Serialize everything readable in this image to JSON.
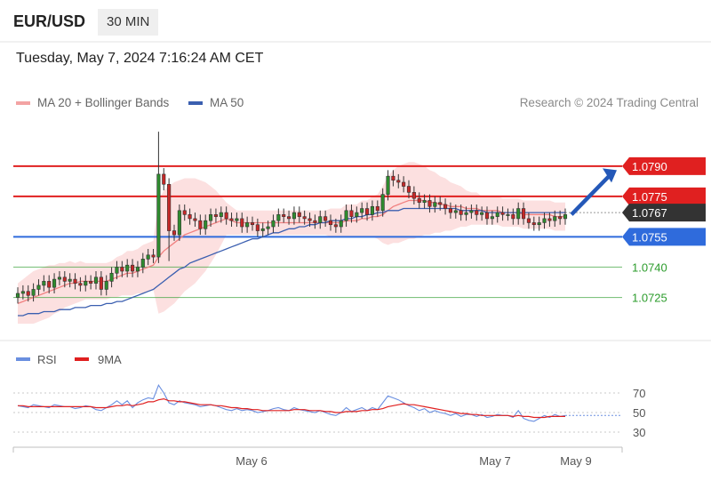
{
  "header": {
    "symbol": "EUR/USD",
    "timeframe": "30 MIN"
  },
  "timestamp": "Tuesday, May 7, 2024 7:16:24 AM CET",
  "legend": {
    "ma20": {
      "label": "MA 20 + Bollinger Bands",
      "color": "#f08080"
    },
    "ma50": {
      "label": "MA 50",
      "color": "#3b5fb0"
    }
  },
  "credit": "Research © 2024 Trading Central",
  "rsi_legend": {
    "rsi": {
      "label": "RSI",
      "color": "#6a8fe0"
    },
    "ma9": {
      "label": "9MA",
      "color": "#e02020"
    }
  },
  "chart_data": {
    "type": "candlestick",
    "price_ylim": [
      1.0705,
      1.0815
    ],
    "levels": [
      {
        "value": "1.0790",
        "num": 1.079,
        "kind": "resistance",
        "color": "#e02020",
        "badge": true
      },
      {
        "value": "1.0775",
        "num": 1.0775,
        "kind": "resistance",
        "color": "#e02020",
        "badge": true
      },
      {
        "value": "1.0767",
        "num": 1.0767,
        "kind": "current",
        "color": "#333333",
        "badge": true
      },
      {
        "value": "1.0755",
        "num": 1.0755,
        "kind": "pivot",
        "color": "#2f6bdc",
        "badge": true
      },
      {
        "value": "1.0740",
        "num": 1.074,
        "kind": "support",
        "color": "#2c9c2c",
        "badge": false
      },
      {
        "value": "1.0725",
        "num": 1.0725,
        "kind": "support",
        "color": "#2c9c2c",
        "badge": false
      }
    ],
    "forecast_target": 1.0788,
    "x_ticks": [
      "May 6",
      "May 7",
      "May 9"
    ],
    "rsi_ticks": [
      "70",
      "50",
      "30"
    ],
    "rsi_ylim": [
      20,
      90
    ],
    "candles_close": [
      1.0727,
      1.0728,
      1.0726,
      1.0729,
      1.0731,
      1.0733,
      1.073,
      1.0734,
      1.0735,
      1.0733,
      1.0734,
      1.0732,
      1.0731,
      1.0733,
      1.0732,
      1.0735,
      1.0729,
      1.0733,
      1.0737,
      1.074,
      1.0738,
      1.0741,
      1.0738,
      1.074,
      1.0744,
      1.0746,
      1.0745,
      1.0786,
      1.0781,
      1.0758,
      1.0756,
      1.0768,
      1.0766,
      1.0764,
      1.0763,
      1.0759,
      1.0763,
      1.0766,
      1.0765,
      1.0767,
      1.0764,
      1.0763,
      1.0764,
      1.076,
      1.0762,
      1.0761,
      1.0758,
      1.0759,
      1.076,
      1.0763,
      1.0766,
      1.0765,
      1.0764,
      1.0767,
      1.0765,
      1.0764,
      1.0763,
      1.0762,
      1.0765,
      1.0763,
      1.0761,
      1.076,
      1.0763,
      1.0768,
      1.0765,
      1.0767,
      1.0769,
      1.0766,
      1.077,
      1.0768,
      1.0776,
      1.0785,
      1.0783,
      1.0782,
      1.078,
      1.0777,
      1.0774,
      1.0772,
      1.0773,
      1.077,
      1.0772,
      1.0771,
      1.0769,
      1.0767,
      1.0768,
      1.0766,
      1.0767,
      1.0768,
      1.0766,
      1.0767,
      1.0764,
      1.0765,
      1.0767,
      1.0766,
      1.0766,
      1.0764,
      1.0769,
      1.0764,
      1.0762,
      1.0761,
      1.0762,
      1.0764,
      1.0763,
      1.0765,
      1.0764,
      1.0766
    ],
    "ma20": [
      1.0722,
      1.0723,
      1.0724,
      1.0725,
      1.0726,
      1.0727,
      1.0728,
      1.0729,
      1.073,
      1.0731,
      1.0732,
      1.0732,
      1.0733,
      1.0733,
      1.0733,
      1.0733,
      1.0733,
      1.0733,
      1.0734,
      1.0735,
      1.0736,
      1.0737,
      1.0737,
      1.0738,
      1.0739,
      1.074,
      1.0741,
      1.0745,
      1.0748,
      1.075,
      1.0752,
      1.0754,
      1.0756,
      1.0757,
      1.0758,
      1.0759,
      1.076,
      1.0761,
      1.0762,
      1.0763,
      1.0764,
      1.0763,
      1.0762,
      1.0762,
      1.0762,
      1.0762,
      1.0762,
      1.0762,
      1.0762,
      1.0762,
      1.0762,
      1.0762,
      1.0762,
      1.0762,
      1.0762,
      1.0762,
      1.0762,
      1.0762,
      1.0762,
      1.0762,
      1.0762,
      1.0762,
      1.0762,
      1.0763,
      1.0763,
      1.0763,
      1.0764,
      1.0764,
      1.0765,
      1.0765,
      1.0766,
      1.0768,
      1.077,
      1.0771,
      1.0772,
      1.0773,
      1.0773,
      1.0773,
      1.0773,
      1.0772,
      1.0772,
      1.0771,
      1.0771,
      1.077,
      1.077,
      1.077,
      1.0769,
      1.0769,
      1.0769,
      1.0768,
      1.0768,
      1.0768,
      1.0768,
      1.0767,
      1.0767,
      1.0767,
      1.0767,
      1.0766,
      1.0766,
      1.0766,
      1.0766,
      1.0766,
      1.0766,
      1.0765,
      1.0765,
      1.0765
    ],
    "ma50": [
      1.0716,
      1.0716,
      1.0717,
      1.0717,
      1.0717,
      1.0718,
      1.0718,
      1.0718,
      1.0719,
      1.0719,
      1.0719,
      1.072,
      1.072,
      1.072,
      1.0721,
      1.0721,
      1.0721,
      1.0722,
      1.0722,
      1.0723,
      1.0723,
      1.0724,
      1.0725,
      1.0726,
      1.0727,
      1.0728,
      1.0729,
      1.0731,
      1.0733,
      1.0735,
      1.0737,
      1.0739,
      1.074,
      1.0742,
      1.0743,
      1.0744,
      1.0745,
      1.0746,
      1.0747,
      1.0748,
      1.0749,
      1.075,
      1.0751,
      1.0752,
      1.0753,
      1.0754,
      1.0754,
      1.0755,
      1.0756,
      1.0757,
      1.0757,
      1.0758,
      1.0759,
      1.0759,
      1.076,
      1.076,
      1.0761,
      1.0761,
      1.0762,
      1.0762,
      1.0763,
      1.0763,
      1.0763,
      1.0764,
      1.0764,
      1.0765,
      1.0765,
      1.0766,
      1.0766,
      1.0767,
      1.0767,
      1.0768,
      1.0768,
      1.0768,
      1.0769,
      1.0769,
      1.0769,
      1.0769,
      1.0769,
      1.0769,
      1.0769,
      1.0769,
      1.0769,
      1.0769,
      1.0769,
      1.0768,
      1.0768,
      1.0768,
      1.0768,
      1.0768,
      1.0767,
      1.0767,
      1.0767,
      1.0767,
      1.0767,
      1.0767,
      1.0767,
      1.0767,
      1.0767,
      1.0767,
      1.0767,
      1.0767,
      1.0767,
      1.0767,
      1.0767,
      1.0767
    ],
    "bb_width": [
      0.001,
      0.0011,
      0.0012,
      0.0013,
      0.0013,
      0.0013,
      0.0013,
      0.0012,
      0.0012,
      0.0011,
      0.0011,
      0.001,
      0.001,
      0.0009,
      0.0009,
      0.0009,
      0.0009,
      0.0009,
      0.0009,
      0.001,
      0.001,
      0.0011,
      0.0011,
      0.0011,
      0.0012,
      0.0012,
      0.0012,
      0.0028,
      0.003,
      0.003,
      0.003,
      0.0029,
      0.0028,
      0.0027,
      0.0026,
      0.0024,
      0.0022,
      0.0019,
      0.0016,
      0.0012,
      0.0008,
      0.0007,
      0.0006,
      0.0006,
      0.0006,
      0.0006,
      0.0006,
      0.0006,
      0.0006,
      0.0006,
      0.0006,
      0.0006,
      0.0006,
      0.0006,
      0.0006,
      0.0006,
      0.0006,
      0.0006,
      0.0006,
      0.0006,
      0.0007,
      0.0007,
      0.0007,
      0.0008,
      0.0008,
      0.0008,
      0.0009,
      0.0009,
      0.001,
      0.0011,
      0.0014,
      0.0017,
      0.0018,
      0.0019,
      0.0019,
      0.0019,
      0.0019,
      0.0018,
      0.0017,
      0.0016,
      0.0015,
      0.0014,
      0.0013,
      0.0012,
      0.0011,
      0.001,
      0.0009,
      0.0008,
      0.0008,
      0.0007,
      0.0007,
      0.0007,
      0.0007,
      0.0007,
      0.0007,
      0.0007,
      0.0007,
      0.0007,
      0.0007,
      0.0007,
      0.0007,
      0.0007,
      0.0007,
      0.0007,
      0.0007,
      0.0007
    ],
    "rsi": [
      57,
      56,
      55,
      58,
      57,
      56,
      55,
      58,
      57,
      56,
      56,
      54,
      55,
      57,
      56,
      53,
      52,
      55,
      58,
      62,
      58,
      62,
      55,
      60,
      63,
      65,
      64,
      78,
      70,
      60,
      58,
      62,
      60,
      59,
      58,
      56,
      57,
      58,
      57,
      55,
      53,
      52,
      54,
      52,
      53,
      52,
      50,
      51,
      52,
      54,
      55,
      53,
      52,
      55,
      53,
      52,
      51,
      50,
      52,
      50,
      48,
      47,
      50,
      55,
      51,
      53,
      55,
      52,
      55,
      53,
      60,
      67,
      65,
      63,
      60,
      57,
      55,
      52,
      54,
      50,
      52,
      50,
      49,
      47,
      49,
      46,
      48,
      48,
      46,
      48,
      45,
      46,
      48,
      47,
      47,
      45,
      52,
      44,
      42,
      41,
      44,
      47,
      45,
      48,
      46,
      47
    ],
    "rsi_ma9": [
      57,
      57,
      56,
      56,
      56,
      56,
      56,
      56,
      56,
      56,
      56,
      56,
      56,
      56,
      56,
      55,
      55,
      55,
      56,
      57,
      57,
      58,
      57,
      58,
      59,
      61,
      61,
      63,
      64,
      62,
      62,
      61,
      61,
      60,
      59,
      58,
      58,
      58,
      57,
      57,
      56,
      55,
      55,
      54,
      54,
      53,
      53,
      52,
      52,
      52,
      52,
      52,
      52,
      53,
      53,
      53,
      52,
      52,
      52,
      51,
      51,
      50,
      50,
      51,
      51,
      51,
      52,
      52,
      53,
      53,
      54,
      56,
      57,
      58,
      59,
      58,
      58,
      57,
      56,
      55,
      54,
      53,
      52,
      51,
      50,
      49,
      49,
      48,
      48,
      47,
      47,
      47,
      47,
      47,
      47,
      46,
      47,
      46,
      46,
      45,
      45,
      45,
      46,
      46,
      46,
      46
    ]
  }
}
